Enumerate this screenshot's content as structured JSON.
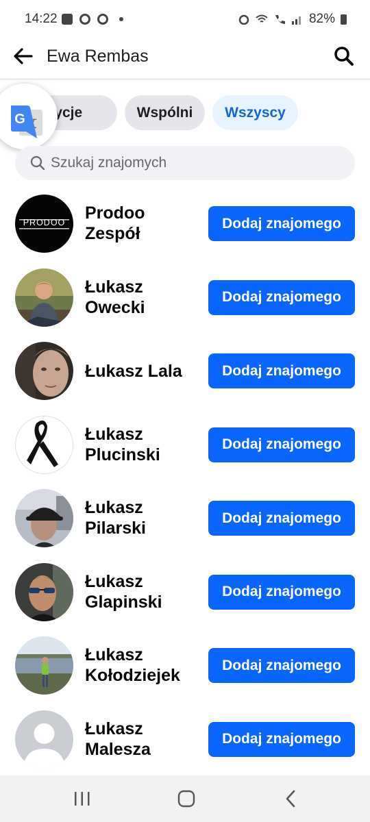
{
  "status_bar": {
    "time": "14:22",
    "battery": "82%"
  },
  "header": {
    "title": "Ewa Rembas"
  },
  "tabs": [
    {
      "label": "Propozycje",
      "visible_label": "ozycje"
    },
    {
      "label": "Wspólni"
    },
    {
      "label": "Wszyscy",
      "active": true
    }
  ],
  "search": {
    "placeholder": "Szukaj znajomych"
  },
  "friends": [
    {
      "name": "Prodoo Zespół",
      "button": "Dodaj znajomego",
      "avatar_text": "PRODOO"
    },
    {
      "name": "Łukasz Owecki",
      "button": "Dodaj znajomego"
    },
    {
      "name": "Łukasz Lala",
      "button": "Dodaj znajomego"
    },
    {
      "name": "Łukasz Plucinski",
      "button": "Dodaj znajomego"
    },
    {
      "name": "Łukasz Pilarski",
      "button": "Dodaj znajomego"
    },
    {
      "name": "Łukasz Glapinski",
      "button": "Dodaj znajomego"
    },
    {
      "name": "Łukasz Kołodziejek",
      "button": "Dodaj znajomego"
    },
    {
      "name": "Łukasz Malesza",
      "button": "Dodaj znajomego"
    }
  ],
  "colors": {
    "accent": "#0866ff",
    "active_tab_text": "#1366d4",
    "active_tab_bg": "#e7f3ff"
  }
}
